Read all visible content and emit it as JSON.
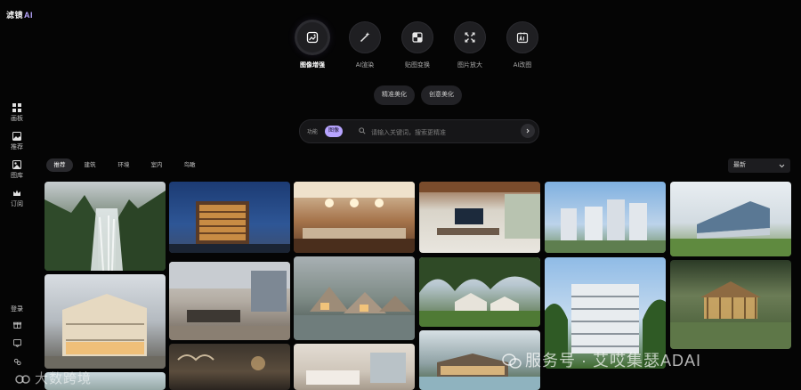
{
  "app": {
    "title": "滤镜",
    "title_accent": "AI"
  },
  "sidebar": {
    "items": [
      {
        "label": "画板",
        "icon": "grid-icon"
      },
      {
        "label": "推荐",
        "icon": "image-icon"
      },
      {
        "label": "图库",
        "icon": "gallery-icon"
      },
      {
        "label": "订阅",
        "icon": "crown-icon"
      }
    ],
    "login_label": "登录",
    "bottom_icons": [
      "gift-icon",
      "message-icon",
      "community-icon"
    ]
  },
  "tools": [
    {
      "label": "图像增强",
      "icon": "enhance-icon",
      "active": true
    },
    {
      "label": "AI渲染",
      "icon": "magic-wand-icon",
      "active": false
    },
    {
      "label": "贴图变换",
      "icon": "swap-icon",
      "active": false
    },
    {
      "label": "图片放大",
      "icon": "expand-icon",
      "active": false
    },
    {
      "label": "AI改图",
      "icon": "ai-edit-icon",
      "active": false
    }
  ],
  "subtabs": [
    "精准美化",
    "创意美化"
  ],
  "search": {
    "tag_function": "功能",
    "tag_selected": "图像",
    "placeholder": "请输入关键词，搜索更精准"
  },
  "categories": [
    {
      "label": "推荐",
      "active": true
    },
    {
      "label": "建筑",
      "active": false
    },
    {
      "label": "环境",
      "active": false
    },
    {
      "label": "室内",
      "active": false
    },
    {
      "label": "鸟瞰",
      "active": false
    }
  ],
  "sort": {
    "selected": "最新"
  },
  "watermarks": {
    "left": "大数跨境",
    "right": "服务号 · 艾哎集瑟ADAI"
  },
  "colors": {
    "accent": "#b7a4ff",
    "background": "#050505"
  }
}
